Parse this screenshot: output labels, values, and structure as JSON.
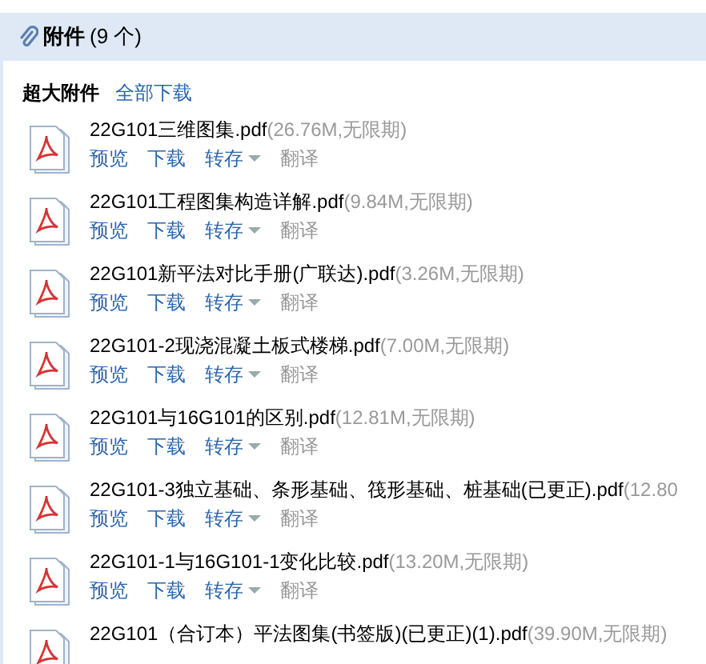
{
  "header": {
    "title": "附件",
    "count": "(9 个)"
  },
  "toolbar": {
    "label": "超大附件",
    "link": "全部下载"
  },
  "files": [
    {
      "name": "22G101三维图集.pdf",
      "size": "(26.76M,无限期)",
      "actions": [
        {
          "label": "预览",
          "dropdown": false,
          "disabled": false
        },
        {
          "label": "下载",
          "dropdown": false,
          "disabled": false
        },
        {
          "label": "转存",
          "dropdown": true,
          "disabled": false
        },
        {
          "label": "翻译",
          "dropdown": false,
          "disabled": true
        }
      ]
    },
    {
      "name": "22G101工程图集构造详解.pdf",
      "size": "(9.84M,无限期)",
      "actions": [
        {
          "label": "预览",
          "dropdown": false,
          "disabled": false
        },
        {
          "label": "下载",
          "dropdown": false,
          "disabled": false
        },
        {
          "label": "转存",
          "dropdown": true,
          "disabled": false
        },
        {
          "label": "翻译",
          "dropdown": false,
          "disabled": true
        }
      ]
    },
    {
      "name": "22G101新平法对比手册(广联达).pdf",
      "size": "(3.26M,无限期)",
      "actions": [
        {
          "label": "预览",
          "dropdown": false,
          "disabled": false
        },
        {
          "label": "下载",
          "dropdown": false,
          "disabled": false
        },
        {
          "label": "转存",
          "dropdown": true,
          "disabled": false
        },
        {
          "label": "翻译",
          "dropdown": false,
          "disabled": true
        }
      ]
    },
    {
      "name": "22G101-2现浇混凝土板式楼梯.pdf",
      "size": "(7.00M,无限期)",
      "actions": [
        {
          "label": "预览",
          "dropdown": false,
          "disabled": false
        },
        {
          "label": "下载",
          "dropdown": false,
          "disabled": false
        },
        {
          "label": "转存",
          "dropdown": true,
          "disabled": false
        },
        {
          "label": "翻译",
          "dropdown": false,
          "disabled": true
        }
      ]
    },
    {
      "name": "22G101与16G101的区别.pdf",
      "size": "(12.81M,无限期)",
      "actions": [
        {
          "label": "预览",
          "dropdown": false,
          "disabled": false
        },
        {
          "label": "下载",
          "dropdown": false,
          "disabled": false
        },
        {
          "label": "转存",
          "dropdown": true,
          "disabled": false
        },
        {
          "label": "翻译",
          "dropdown": false,
          "disabled": true
        }
      ]
    },
    {
      "name": "22G101-3独立基础、条形基础、筏形基础、桩基础(已更正).pdf",
      "size": "(12.80",
      "actions": [
        {
          "label": "预览",
          "dropdown": false,
          "disabled": false
        },
        {
          "label": "下载",
          "dropdown": false,
          "disabled": false
        },
        {
          "label": "转存",
          "dropdown": true,
          "disabled": false
        },
        {
          "label": "翻译",
          "dropdown": false,
          "disabled": true
        }
      ]
    },
    {
      "name": "22G101-1与16G101-1变化比较.pdf",
      "size": "(13.20M,无限期)",
      "actions": [
        {
          "label": "预览",
          "dropdown": false,
          "disabled": false
        },
        {
          "label": "下载",
          "dropdown": false,
          "disabled": false
        },
        {
          "label": "转存",
          "dropdown": true,
          "disabled": false
        },
        {
          "label": "翻译",
          "dropdown": false,
          "disabled": true
        }
      ]
    },
    {
      "name": "22G101（合订本）平法图集(书签版)(已更正)(1).pdf",
      "size": "(39.90M,无限期)"
    }
  ]
}
